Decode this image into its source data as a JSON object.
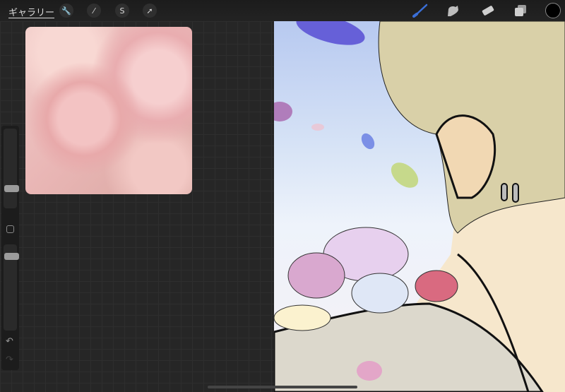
{
  "topbar": {
    "gallery_label": "ギャラリー",
    "left_tools": [
      "wrench-icon",
      "magic-wand-icon",
      "selection-icon",
      "transform-arrow-icon"
    ],
    "right_tools": [
      "brush-icon",
      "smudge-icon",
      "eraser-icon",
      "layers-icon"
    ],
    "current_color": "#000000",
    "brush_accent": "#3a6fd8"
  },
  "sidebar": {
    "brush_size": 0.22,
    "opacity": 0.89
  }
}
